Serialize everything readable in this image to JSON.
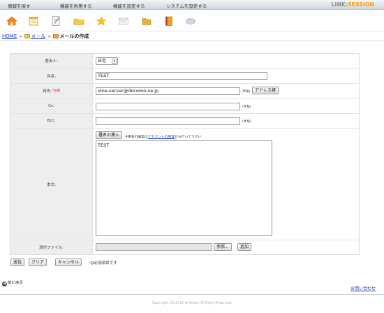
{
  "menu": {
    "items": [
      "情報を探す",
      "機能を利用する",
      "機能を設定する",
      "システムを設定する"
    ],
    "logo_prefix": "LINK",
    "logo_accent": "SESSION"
  },
  "toolbar": {
    "icons": [
      "home-icon",
      "calendar-icon",
      "memo-icon",
      "folder-icon",
      "star-icon",
      "mail-icon",
      "folder-icon",
      "book-icon",
      "disc-icon"
    ]
  },
  "breadcrumb": {
    "home": "HOME",
    "mail": "メール",
    "current": "メールの作成",
    "separator": ">"
  },
  "form": {
    "sender": {
      "label": "差出人:",
      "value": "自宅"
    },
    "subject": {
      "label": "件名:",
      "value": "TEST"
    },
    "to": {
      "label": "宛先:",
      "required_mark": "*必須",
      "value": "vine-server@docomo.ne.jp",
      "hint": "(半角)",
      "address_button": "アドレス帳"
    },
    "cc": {
      "label": "Cc:",
      "value": "",
      "hint": "(半角)"
    },
    "bcc": {
      "label": "Bcc:",
      "value": "",
      "hint": "(半角)"
    },
    "body": {
      "label": "本文:",
      "signature_button": "署名の挿入",
      "note_prefix": "※署名の編集は",
      "note_link": "アカウントの管理",
      "note_suffix": "から行って下さい",
      "value": "TEST"
    },
    "attachment": {
      "label": "添付ファイル:",
      "browse_button": "参照...",
      "add_button": "追加"
    }
  },
  "actions": {
    "send": "送信",
    "clear": "クリア",
    "cancel": "キャンセル",
    "required_note_mark": "*",
    "required_note": "は必須項目です"
  },
  "footer": {
    "back": "前に戻る",
    "contact": "お問い合わせ",
    "copyright": "Copyright (C) 2011 In Artion All Right Reserved."
  },
  "colors": {
    "link": "#1a3cc8",
    "required": "#e00000",
    "accent": "#ff9a00",
    "label_bg": "#eeeeee"
  }
}
